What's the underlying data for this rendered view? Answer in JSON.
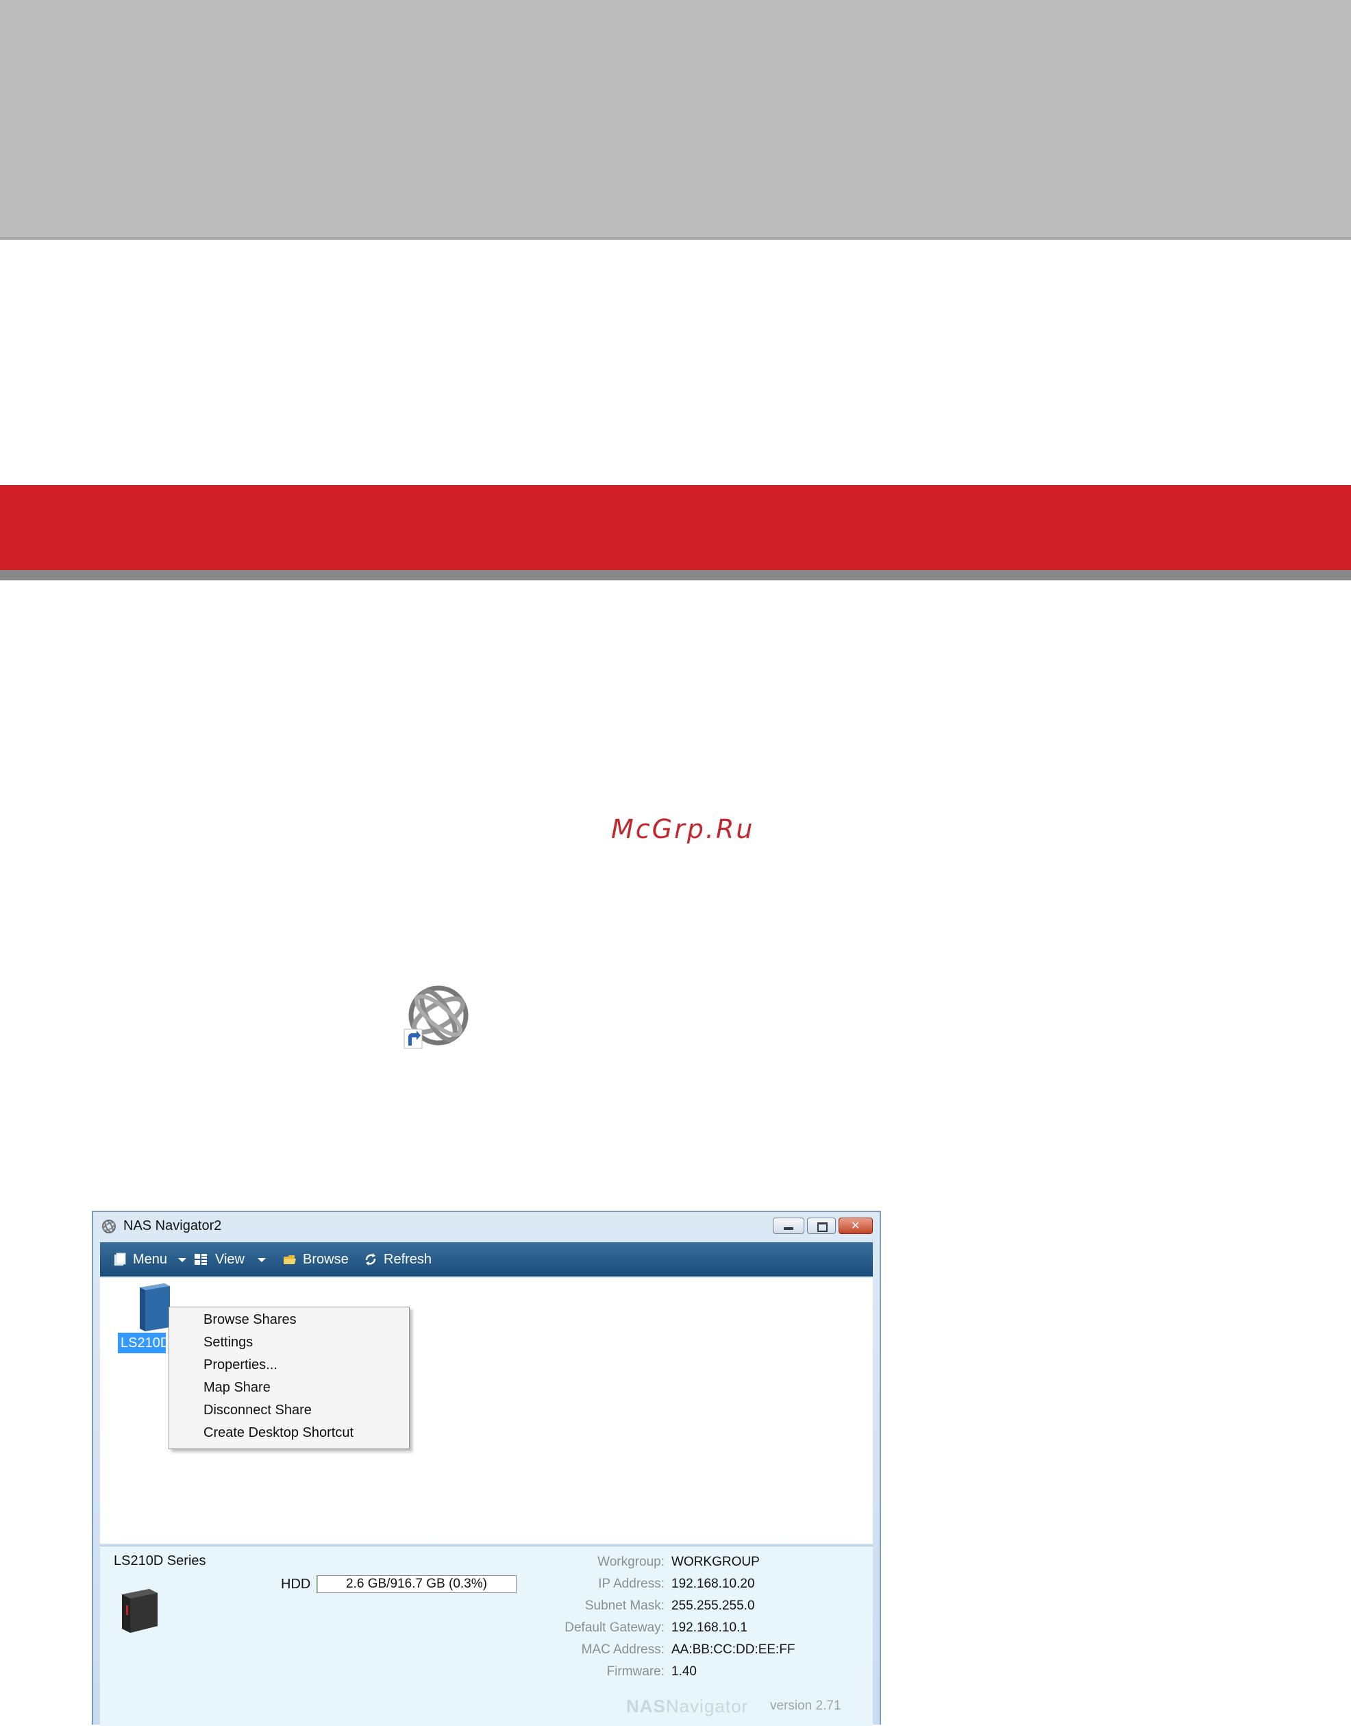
{
  "watermark": "McGrp.Ru",
  "window": {
    "title": "NAS Navigator2",
    "toolbar": {
      "menu_label": "Menu",
      "view_label": "View",
      "browse_label": "Browse",
      "refresh_label": "Refresh"
    },
    "device": {
      "label": "LS210D"
    },
    "context_menu": {
      "items": [
        "Browse Shares",
        "Settings",
        "Properties...",
        "Map Share",
        "Disconnect Share",
        "Create Desktop Shortcut"
      ]
    },
    "info": {
      "series": "LS210D Series",
      "hdd_label": "HDD",
      "hdd_usage": "2.6 GB/916.7 GB (0.3%)",
      "hdd_fraction": 0.003,
      "network": [
        {
          "key": "Workgroup:",
          "value": "WORKGROUP"
        },
        {
          "key": "IP Address:",
          "value": "192.168.10.20"
        },
        {
          "key": "Subnet Mask:",
          "value": "255.255.255.0"
        },
        {
          "key": "Default Gateway:",
          "value": "192.168.10.1"
        },
        {
          "key": "MAC Address:",
          "value": "AA:BB:CC:DD:EE:FF"
        },
        {
          "key": "Firmware:",
          "value": "1.40"
        }
      ],
      "brand_nas": "NAS",
      "brand_navigator": "Navigator",
      "version": "version 2.71"
    }
  },
  "colors": {
    "red_band": "#d01f26",
    "gray_band": "#bcbcbc",
    "toolbar": "#194b79",
    "selection": "#3399ff"
  }
}
